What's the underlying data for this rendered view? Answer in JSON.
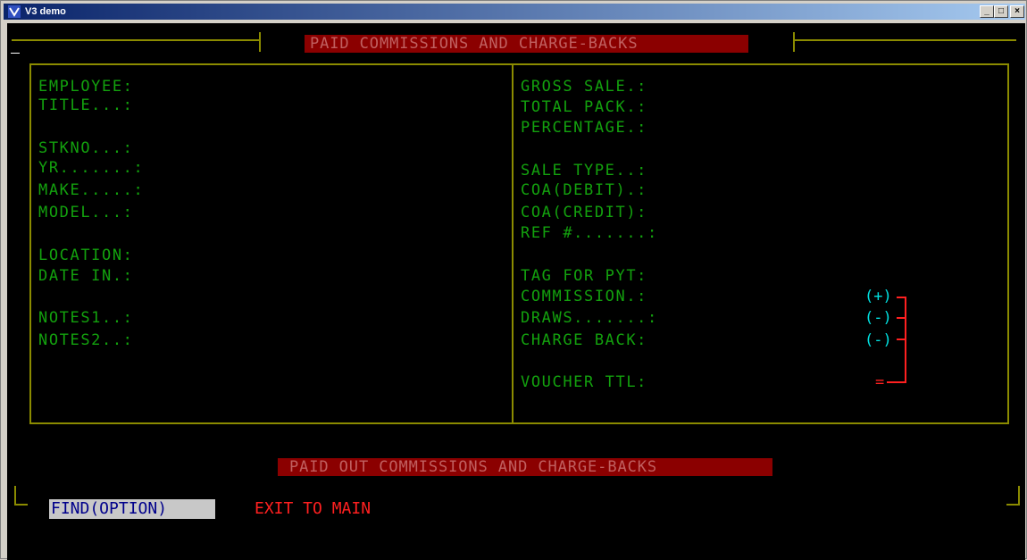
{
  "window": {
    "title": "V3 demo",
    "controls": [
      "_",
      "□",
      "×"
    ]
  },
  "header": {
    "banner": "PAID COMMISSIONS AND CHARGE-BACKS"
  },
  "left_panel": {
    "fields": [
      "EMPLOYEE:",
      "TITLE...:",
      "",
      "STKNO...:",
      "YR.......:",
      "MAKE.....:",
      "MODEL...:",
      "",
      "LOCATION:",
      "DATE IN.:",
      "",
      "NOTES1..:",
      "NOTES2..:"
    ]
  },
  "right_panel": {
    "fields": [
      "GROSS SALE.:",
      "TOTAL PACK.:",
      "PERCENTAGE.:",
      "",
      "SALE TYPE..:",
      "COA(DEBIT).:",
      "COA(CREDIT):",
      "REF #.......:",
      "",
      "TAG FOR PYT:",
      "COMMISSION.:",
      "DRAWS.......:",
      "CHARGE BACK:",
      "",
      "VOUCHER TTL:"
    ],
    "signs": {
      "commission": "(+)",
      "draws": "(-)",
      "charge_back": "(-)",
      "total": "="
    }
  },
  "footer": {
    "banner": "PAID OUT COMMISSIONS AND CHARGE-BACKS",
    "find_label": "FIND(OPTION)",
    "exit_label": "EXIT TO MAIN"
  },
  "colors": {
    "field_green": "#13a10e",
    "border_olive": "#8b8b00",
    "banner_bg": "#8b0000",
    "sign_cyan": "#00e0e0",
    "alert_red": "#ff2020"
  }
}
